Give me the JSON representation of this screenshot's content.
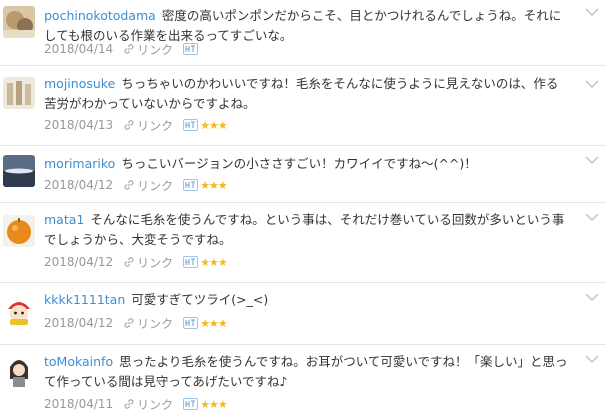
{
  "comments": [
    {
      "username": "pochinokotodama",
      "text": "密度の高いポンポンだからこそ、目とかつけれるんでしょうね。それにしても根のいる作業を出来るってすごいな。",
      "date": "2018/04/14",
      "link_label": "リンク",
      "stars": ""
    },
    {
      "username": "mojinosuke",
      "text": "ちっちゃいのかわいいですね！毛糸をそんなに使うように見えないのは、作る苦労がわかっていないからですよね。",
      "date": "2018/04/13",
      "link_label": "リンク",
      "stars": "★★★"
    },
    {
      "username": "morimariko",
      "text": "ちっこいバージョンの小ささすごい！カワイイですね〜(^^)！",
      "date": "2018/04/12",
      "link_label": "リンク",
      "stars": "★★★"
    },
    {
      "username": "mata1",
      "text": "そんなに毛糸を使うんですね。という事は、それだけ巻いている回数が多いという事でしょうから、大変そうですね。",
      "date": "2018/04/12",
      "link_label": "リンク",
      "stars": "★★★"
    },
    {
      "username": "kkkk1111tan",
      "text": "可愛すぎてツライ(>_<)",
      "date": "2018/04/12",
      "link_label": "リンク",
      "stars": "★★★"
    },
    {
      "username": "toMokainfo",
      "text": "思ったより毛糸を使うんですね。お耳がついて可愛いですね！「楽しい」と思って作っている間は見守ってあげたいですね♪",
      "date": "2018/04/11",
      "link_label": "リンク",
      "stars": "★★★"
    }
  ]
}
